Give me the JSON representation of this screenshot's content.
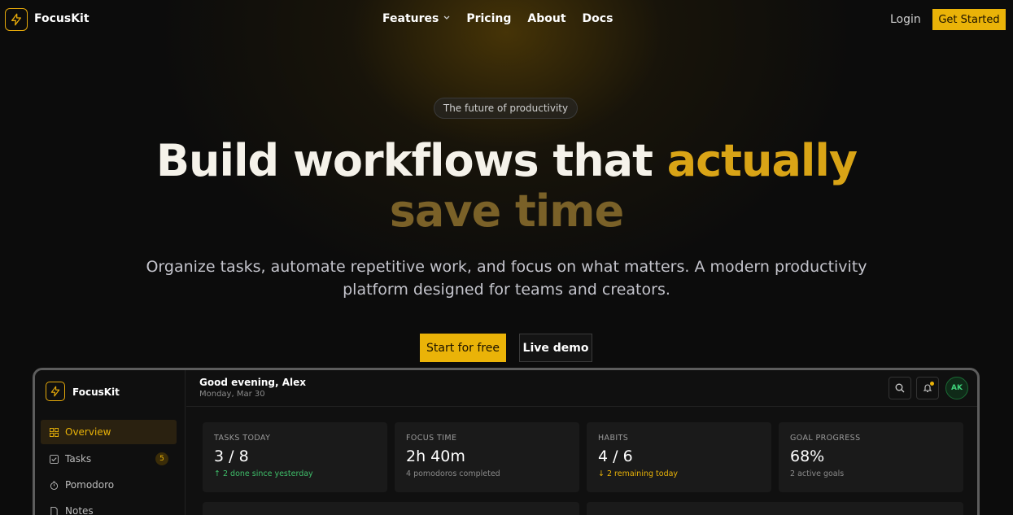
{
  "nav": {
    "brand": "FocusKit",
    "links": [
      {
        "label": "Features",
        "has_dropdown": true
      },
      {
        "label": "Pricing"
      },
      {
        "label": "About"
      },
      {
        "label": "Docs"
      }
    ],
    "login": "Login",
    "cta": "Get Started"
  },
  "hero": {
    "pill": "The future of productivity",
    "title_white": "Build workflows that ",
    "title_gold_1": "actually",
    "title_gold_2": "save time",
    "subtitle_line1": "Organize tasks, automate repetitive work, and focus on what matters. A modern productivity",
    "subtitle_line2": "platform designed for teams and creators.",
    "primary_button": "Start for free",
    "secondary_button": "Live demo"
  },
  "dashboard": {
    "brand": "FocusKit",
    "greeting": "Good evening, Alex",
    "date": "Monday, Mar 30",
    "avatar_initials": "AK",
    "sidebar": [
      {
        "label": "Overview",
        "icon": "grid-icon",
        "active": true
      },
      {
        "label": "Tasks",
        "icon": "check-square-icon",
        "badge": "5"
      },
      {
        "label": "Pomodoro",
        "icon": "timer-icon"
      },
      {
        "label": "Notes",
        "icon": "file-icon"
      }
    ],
    "stats": [
      {
        "label": "TASKS TODAY",
        "value": "3 / 8",
        "note": "↑ 2 done since yesterday",
        "note_style": "green"
      },
      {
        "label": "FOCUS TIME",
        "value": "2h 40m",
        "note": "4 pomodoros completed",
        "note_style": "muted"
      },
      {
        "label": "HABITS",
        "value": "4 / 6",
        "note": "↓ 2 remaining today",
        "note_style": "amber"
      },
      {
        "label": "GOAL PROGRESS",
        "value": "68%",
        "note": "2 active goals",
        "note_style": "muted"
      }
    ]
  },
  "colors": {
    "accent": "#eab308",
    "background": "#0c0c0c",
    "success": "#3fbf6a"
  }
}
